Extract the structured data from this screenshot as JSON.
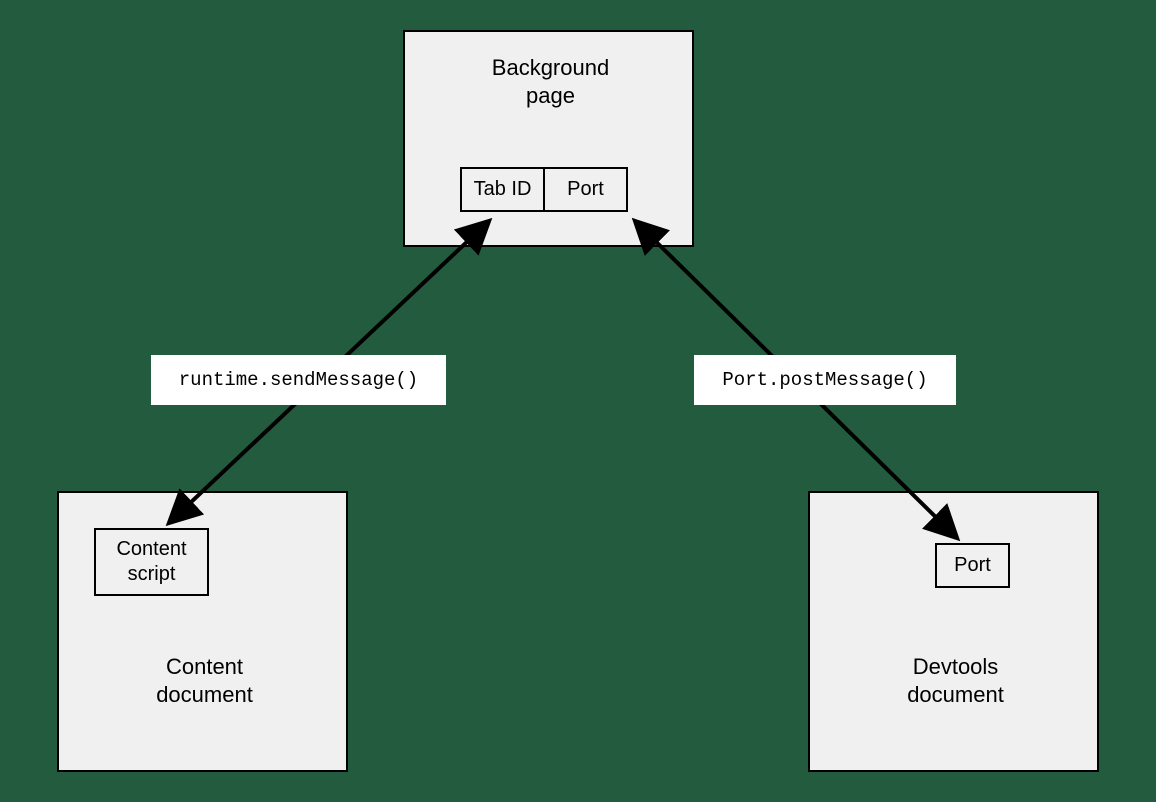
{
  "background": {
    "title": "Background\npage",
    "tab_id": "Tab ID",
    "port": "Port"
  },
  "content_doc": {
    "title": "Content\ndocument",
    "script": "Content\nscript"
  },
  "devtools_doc": {
    "title": "Devtools\ndocument",
    "port": "Port"
  },
  "messages": {
    "runtime": "runtime.sendMessage()",
    "port_post": "Port.postMessage()"
  }
}
